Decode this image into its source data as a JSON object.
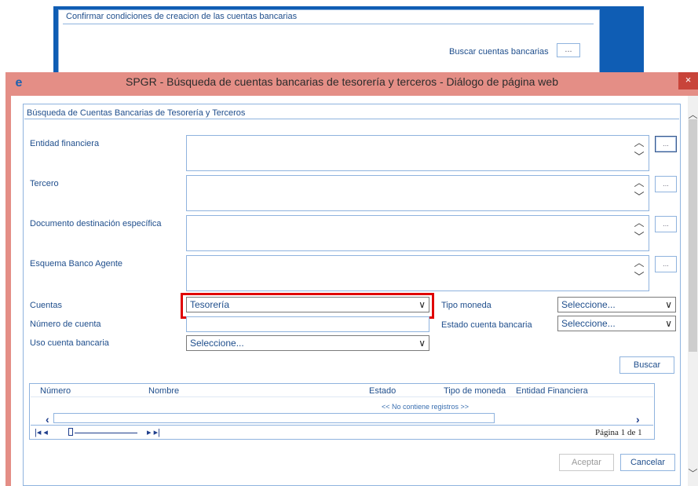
{
  "background": {
    "panel_title": "Confirmar condiciones de creacion de las cuentas bancarias",
    "buscar_label": "Buscar cuentas bancarias",
    "dots": "..."
  },
  "dialog": {
    "title": "SPGR - Búsqueda de cuentas bancarias de tesorería y terceros - Diálogo de página web",
    "close": "×",
    "icon": "ie-icon"
  },
  "panel": {
    "title": "Búsqueda de Cuentas Bancarias de Tesorería y Terceros"
  },
  "fields": {
    "entidad_financiera": "Entidad financiera",
    "tercero": "Tercero",
    "documento": "Documento destinación específica",
    "esquema": "Esquema Banco Agente",
    "cuentas": "Cuentas",
    "numero_cuenta": "Número de cuenta",
    "uso_cuenta": "Uso cuenta bancaria",
    "tipo_moneda": "Tipo moneda",
    "estado_cuenta": "Estado cuenta bancaria"
  },
  "selects": {
    "cuentas_value": "Tesorería",
    "uso_value": "Seleccione...",
    "tipo_moneda_value": "Seleccione...",
    "estado_value": "Seleccione..."
  },
  "buttons": {
    "dots": "...",
    "buscar": "Buscar",
    "aceptar": "Aceptar",
    "cancelar": "Cancelar"
  },
  "grid": {
    "columns": [
      "Número",
      "Nombre",
      "Estado",
      "Tipo de moneda",
      "Entidad Financiera"
    ],
    "empty_message": "<< No contiene registros >>",
    "page_info": "Página 1 de 1"
  },
  "colors": {
    "accent": "#1f4e8c",
    "dialog_frame": "#e48e86",
    "highlight": "#e00000"
  }
}
